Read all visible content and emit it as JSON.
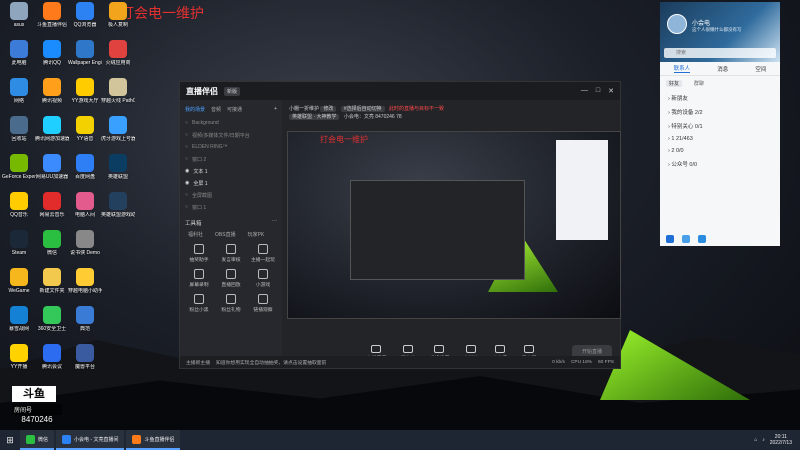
{
  "desktop_title": "打会电一维护",
  "desktop": {
    "icons": [
      {
        "label": "asus",
        "color": "#8fa4bd"
      },
      {
        "label": "斗鱼直播伴侣",
        "color": "#ff7a1a"
      },
      {
        "label": "QQ浏览器",
        "color": "#2c82f2"
      },
      {
        "label": "极人复制",
        "color": "#f2a51c"
      },
      {
        "label": "此电脑",
        "color": "#3d7bd9"
      },
      {
        "label": "腾讯QQ",
        "color": "#1a8cff"
      },
      {
        "label": "Wallpaper Engine...",
        "color": "#2e77c9"
      },
      {
        "label": "火绒应用商",
        "color": "#e0433f"
      },
      {
        "label": "网络",
        "color": "#2f8ce4"
      },
      {
        "label": "腾讯视频",
        "color": "#ff9f1a"
      },
      {
        "label": "YY游戏大厅",
        "color": "#ffcc00"
      },
      {
        "label": "穿越火线 PathOfWa...",
        "color": "#d3c59b"
      },
      {
        "label": "回收站",
        "color": "#4a6b8c"
      },
      {
        "label": "腾讯网游加速器",
        "color": "#1ecfff"
      },
      {
        "label": "YY语音",
        "color": "#f3d100"
      },
      {
        "label": "虎牙游戏上号器",
        "color": "#3aa0ff"
      },
      {
        "label": "GeForce Experience",
        "color": "#76b900"
      },
      {
        "label": "网易UU加速器",
        "color": "#3b8bff"
      },
      {
        "label": "百度网盘",
        "color": "#2e7ef5"
      },
      {
        "label": "英雄联盟",
        "color": "#0b3d63"
      },
      {
        "label": "QQ音乐",
        "color": "#ffcc00"
      },
      {
        "label": "网易云音乐",
        "color": "#e22b2b"
      },
      {
        "label": "电脑人间",
        "color": "#e25b8c"
      },
      {
        "label": "英雄联盟游戏助手",
        "color": "#23405e"
      },
      {
        "label": "Steam",
        "color": "#1b2838"
      },
      {
        "label": "微信",
        "color": "#2bbf42"
      },
      {
        "label": "说书侠 Demo",
        "color": "#888888"
      },
      {
        "label": "",
        "color": "transparent"
      },
      {
        "label": "WeGame",
        "color": "#f5b71c"
      },
      {
        "label": "新建文件夹",
        "color": "#f2c94c"
      },
      {
        "label": "穿越电脑小助手4",
        "color": "#ffcc33"
      },
      {
        "label": "",
        "color": "transparent"
      },
      {
        "label": "暴雪战网",
        "color": "#1481d4"
      },
      {
        "label": "360安全卫士",
        "color": "#34c759"
      },
      {
        "label": "典范",
        "color": "#3a7bd5"
      },
      {
        "label": "",
        "color": "transparent"
      },
      {
        "label": "YY开播",
        "color": "#ffd200"
      },
      {
        "label": "腾讯会议",
        "color": "#2b6cf0"
      },
      {
        "label": "魔兽平台",
        "color": "#3b5ba0"
      },
      {
        "label": "",
        "color": "transparent"
      }
    ]
  },
  "app": {
    "logo": "直播伴侣",
    "version": "新版",
    "window_controls": [
      "—",
      "□",
      "✕"
    ],
    "left_tabs": [
      "我的场景",
      "音频",
      "可接通"
    ],
    "add_label": "+",
    "sources": [
      {
        "label": "Background",
        "on": false
      },
      {
        "label": "视频/多媒体文件/日期平台",
        "on": false
      },
      {
        "label": "ELDEN RING™",
        "on": false
      },
      {
        "label": "窗口 2",
        "on": false
      },
      {
        "label": "文本 1",
        "on": true
      },
      {
        "label": "全屏 1",
        "on": true
      },
      {
        "label": "全屏截图",
        "on": false
      },
      {
        "label": "窗口 1",
        "on": false
      }
    ],
    "toolbox_title": "工具箱",
    "toolbox_tabs": [
      "福利社",
      "OBS直播",
      "玩家PK"
    ],
    "tools": [
      "抽奖助手",
      "发言审核",
      "主播一起玩",
      "屏幕录制",
      "直播回放",
      "小游戏",
      "粉丝小黑",
      "粉丝礼物",
      "链播观察"
    ],
    "room": {
      "title": "小棚一折维护",
      "title_tag": "修改",
      "notice_tag": "#选择后自动切换",
      "notice_red": "此时的直播与目标不一致",
      "row2_tag": "英雄联盟 · 大神教学",
      "host": "小会电：文亮",
      "room_no": "8470246",
      "level": "78"
    },
    "preview_overlay_title": "打会电一维护",
    "bottom_tools": [
      "直播屏幕",
      "摄像头",
      "手机投屏",
      "多媒体",
      "麦克风",
      "扬声器"
    ],
    "start_label": "开始直播",
    "status": {
      "left": "主播新主播",
      "notice": "知道你想用实现全自动抽抽奖，请点击设置抽取面前",
      "bitrate": "0 kb/s",
      "cpu": "CPU 18%",
      "fps": "60 FPS"
    }
  },
  "qq": {
    "name": "小会电",
    "signature": "这个人很懒什么都没有写",
    "search_placeholder": "搜索",
    "tabs": [
      "联系人",
      "消息",
      "空间"
    ],
    "sub_tabs": [
      "好友",
      "群聊"
    ],
    "groups": [
      "新朋友",
      "我的设备 2/2",
      "特别关心 0/1",
      "1  21/463",
      "2  0/0",
      "公众号 0/0"
    ],
    "footer_icon_colors": [
      "#1f6fd6",
      "#4aa0e8",
      "#2c8ce0"
    ]
  },
  "douyu": {
    "logo": "斗鱼",
    "room_label": "房间号",
    "room_number": "8470246"
  },
  "taskbar": {
    "start_icon": "⊞",
    "items": [
      {
        "label": "微信",
        "color": "#2bbf42"
      },
      {
        "label": "小会电 - 文亮直播间",
        "color": "#2c82f2"
      },
      {
        "label": "斗鱼直播伴侣",
        "color": "#ff7a1a"
      }
    ],
    "time": "20:11",
    "date": "2022/7/13"
  }
}
